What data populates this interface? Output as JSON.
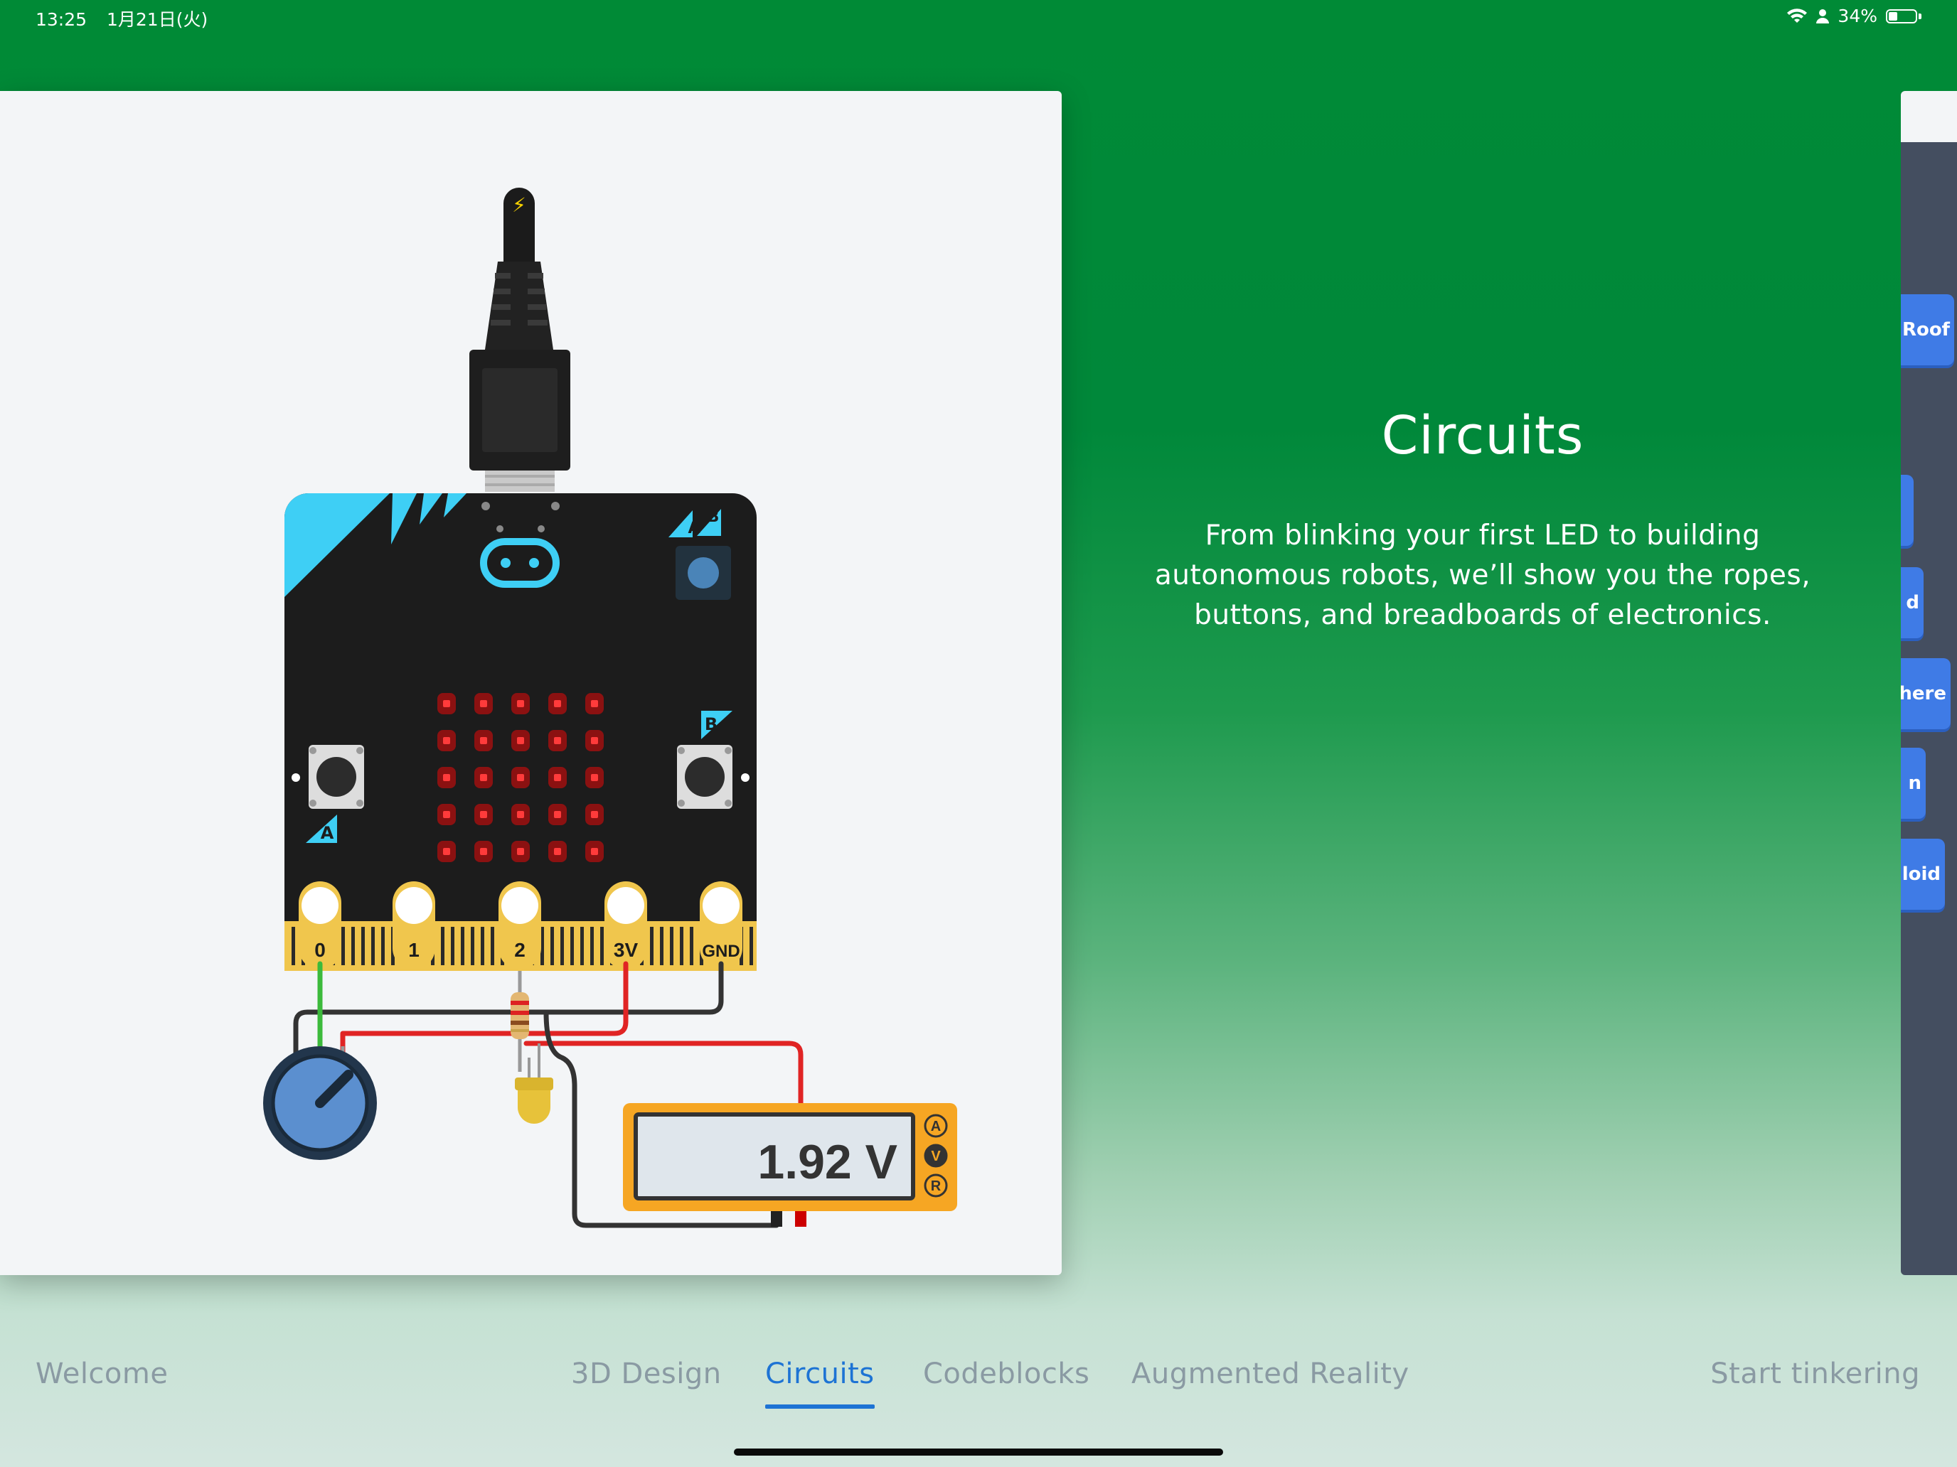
{
  "status_bar": {
    "time": "13:25",
    "date": "1月21日(火)",
    "battery": "34%"
  },
  "hero": {
    "title": "Circuits",
    "description": "From blinking your first LED to building autonomous robots, we’ll show you the ropes, buttons, and breadboards of electronics."
  },
  "illustration": {
    "pins": [
      "0",
      "1",
      "2",
      "3V",
      "GND"
    ],
    "button_a": "A",
    "button_b": "B",
    "multimeter_reading": "1.92 V",
    "multimeter_modes": [
      "A",
      "V",
      "R"
    ]
  },
  "peek_blocks": [
    "Roof",
    "",
    "d",
    "here",
    "n",
    "loid"
  ],
  "tabs": [
    {
      "label": "Welcome"
    },
    {
      "label": "3D Design"
    },
    {
      "label": "Circuits"
    },
    {
      "label": "Codeblocks"
    },
    {
      "label": "Augmented Reality"
    },
    {
      "label": "Start tinkering"
    }
  ],
  "colors": {
    "accent": "#1d73d4",
    "background_green": "#00883a",
    "microbit_body": "#1c1c1c",
    "microbit_accent": "#3ecff5",
    "pin_gold": "#f0c64d",
    "multimeter_orange": "#f6a623"
  }
}
